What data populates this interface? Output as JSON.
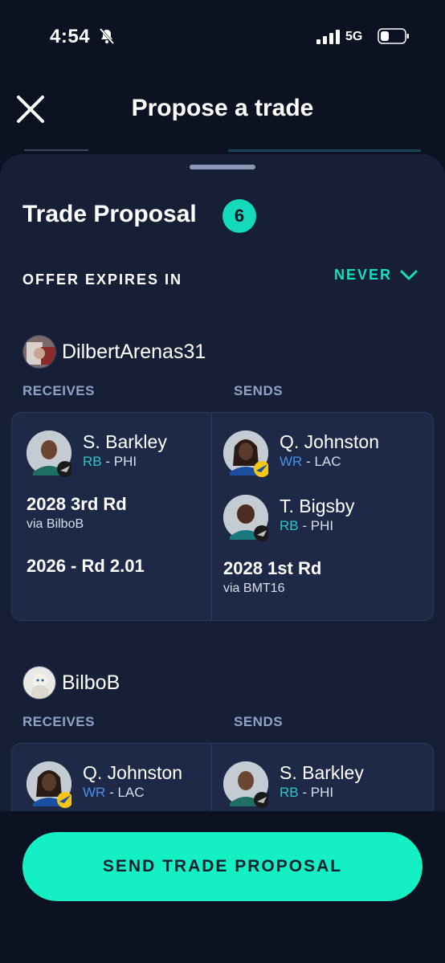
{
  "status": {
    "time": "4:54",
    "network": "5G"
  },
  "header": {
    "title": "Propose a trade"
  },
  "proposal": {
    "title": "Trade Proposal",
    "count": "6",
    "expires_label": "OFFER EXPIRES IN",
    "expires_value": "NEVER"
  },
  "teams": [
    {
      "name": "DilbertArenas31",
      "receives_label": "RECEIVES",
      "sends_label": "SENDS",
      "receives": {
        "players": [
          {
            "name": "S. Barkley",
            "pos": "RB",
            "team": "- PHI"
          }
        ],
        "picks": [
          {
            "name": "2028 3rd Rd",
            "via": "via BilboB"
          },
          {
            "name": "2026 - Rd 2.01",
            "via": ""
          }
        ]
      },
      "sends": {
        "players": [
          {
            "name": "Q. Johnston",
            "pos": "WR",
            "team": "- LAC"
          },
          {
            "name": "T. Bigsby",
            "pos": "RB",
            "team": "- PHI"
          }
        ],
        "picks": [
          {
            "name": "2028 1st Rd",
            "via": "via BMT16"
          }
        ]
      }
    },
    {
      "name": "BilboB",
      "receives_label": "RECEIVES",
      "sends_label": "SENDS",
      "receives": {
        "players": [
          {
            "name": "Q. Johnston",
            "pos": "WR",
            "team": "- LAC"
          }
        ]
      },
      "sends": {
        "players": [
          {
            "name": "S. Barkley",
            "pos": "RB",
            "team": "- PHI"
          }
        ]
      }
    }
  ],
  "action": {
    "send_label": "SEND TRADE PROPOSAL"
  },
  "colors": {
    "accent": "#14f0c4",
    "badge": "#14d9bb",
    "rb": "#2fc6c8",
    "wr": "#4a90e8",
    "background": "#0c1222",
    "sheet": "#161f36"
  }
}
